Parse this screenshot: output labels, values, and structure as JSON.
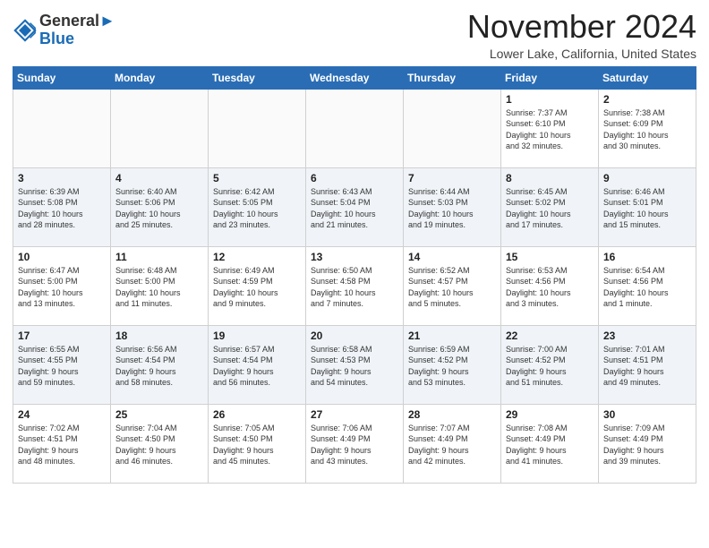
{
  "header": {
    "logo_line1": "General",
    "logo_line2": "Blue",
    "month": "November 2024",
    "location": "Lower Lake, California, United States"
  },
  "weekdays": [
    "Sunday",
    "Monday",
    "Tuesday",
    "Wednesday",
    "Thursday",
    "Friday",
    "Saturday"
  ],
  "weeks": [
    [
      {
        "day": "",
        "info": ""
      },
      {
        "day": "",
        "info": ""
      },
      {
        "day": "",
        "info": ""
      },
      {
        "day": "",
        "info": ""
      },
      {
        "day": "",
        "info": ""
      },
      {
        "day": "1",
        "info": "Sunrise: 7:37 AM\nSunset: 6:10 PM\nDaylight: 10 hours\nand 32 minutes."
      },
      {
        "day": "2",
        "info": "Sunrise: 7:38 AM\nSunset: 6:09 PM\nDaylight: 10 hours\nand 30 minutes."
      }
    ],
    [
      {
        "day": "3",
        "info": "Sunrise: 6:39 AM\nSunset: 5:08 PM\nDaylight: 10 hours\nand 28 minutes."
      },
      {
        "day": "4",
        "info": "Sunrise: 6:40 AM\nSunset: 5:06 PM\nDaylight: 10 hours\nand 25 minutes."
      },
      {
        "day": "5",
        "info": "Sunrise: 6:42 AM\nSunset: 5:05 PM\nDaylight: 10 hours\nand 23 minutes."
      },
      {
        "day": "6",
        "info": "Sunrise: 6:43 AM\nSunset: 5:04 PM\nDaylight: 10 hours\nand 21 minutes."
      },
      {
        "day": "7",
        "info": "Sunrise: 6:44 AM\nSunset: 5:03 PM\nDaylight: 10 hours\nand 19 minutes."
      },
      {
        "day": "8",
        "info": "Sunrise: 6:45 AM\nSunset: 5:02 PM\nDaylight: 10 hours\nand 17 minutes."
      },
      {
        "day": "9",
        "info": "Sunrise: 6:46 AM\nSunset: 5:01 PM\nDaylight: 10 hours\nand 15 minutes."
      }
    ],
    [
      {
        "day": "10",
        "info": "Sunrise: 6:47 AM\nSunset: 5:00 PM\nDaylight: 10 hours\nand 13 minutes."
      },
      {
        "day": "11",
        "info": "Sunrise: 6:48 AM\nSunset: 5:00 PM\nDaylight: 10 hours\nand 11 minutes."
      },
      {
        "day": "12",
        "info": "Sunrise: 6:49 AM\nSunset: 4:59 PM\nDaylight: 10 hours\nand 9 minutes."
      },
      {
        "day": "13",
        "info": "Sunrise: 6:50 AM\nSunset: 4:58 PM\nDaylight: 10 hours\nand 7 minutes."
      },
      {
        "day": "14",
        "info": "Sunrise: 6:52 AM\nSunset: 4:57 PM\nDaylight: 10 hours\nand 5 minutes."
      },
      {
        "day": "15",
        "info": "Sunrise: 6:53 AM\nSunset: 4:56 PM\nDaylight: 10 hours\nand 3 minutes."
      },
      {
        "day": "16",
        "info": "Sunrise: 6:54 AM\nSunset: 4:56 PM\nDaylight: 10 hours\nand 1 minute."
      }
    ],
    [
      {
        "day": "17",
        "info": "Sunrise: 6:55 AM\nSunset: 4:55 PM\nDaylight: 9 hours\nand 59 minutes."
      },
      {
        "day": "18",
        "info": "Sunrise: 6:56 AM\nSunset: 4:54 PM\nDaylight: 9 hours\nand 58 minutes."
      },
      {
        "day": "19",
        "info": "Sunrise: 6:57 AM\nSunset: 4:54 PM\nDaylight: 9 hours\nand 56 minutes."
      },
      {
        "day": "20",
        "info": "Sunrise: 6:58 AM\nSunset: 4:53 PM\nDaylight: 9 hours\nand 54 minutes."
      },
      {
        "day": "21",
        "info": "Sunrise: 6:59 AM\nSunset: 4:52 PM\nDaylight: 9 hours\nand 53 minutes."
      },
      {
        "day": "22",
        "info": "Sunrise: 7:00 AM\nSunset: 4:52 PM\nDaylight: 9 hours\nand 51 minutes."
      },
      {
        "day": "23",
        "info": "Sunrise: 7:01 AM\nSunset: 4:51 PM\nDaylight: 9 hours\nand 49 minutes."
      }
    ],
    [
      {
        "day": "24",
        "info": "Sunrise: 7:02 AM\nSunset: 4:51 PM\nDaylight: 9 hours\nand 48 minutes."
      },
      {
        "day": "25",
        "info": "Sunrise: 7:04 AM\nSunset: 4:50 PM\nDaylight: 9 hours\nand 46 minutes."
      },
      {
        "day": "26",
        "info": "Sunrise: 7:05 AM\nSunset: 4:50 PM\nDaylight: 9 hours\nand 45 minutes."
      },
      {
        "day": "27",
        "info": "Sunrise: 7:06 AM\nSunset: 4:49 PM\nDaylight: 9 hours\nand 43 minutes."
      },
      {
        "day": "28",
        "info": "Sunrise: 7:07 AM\nSunset: 4:49 PM\nDaylight: 9 hours\nand 42 minutes."
      },
      {
        "day": "29",
        "info": "Sunrise: 7:08 AM\nSunset: 4:49 PM\nDaylight: 9 hours\nand 41 minutes."
      },
      {
        "day": "30",
        "info": "Sunrise: 7:09 AM\nSunset: 4:49 PM\nDaylight: 9 hours\nand 39 minutes."
      }
    ]
  ]
}
